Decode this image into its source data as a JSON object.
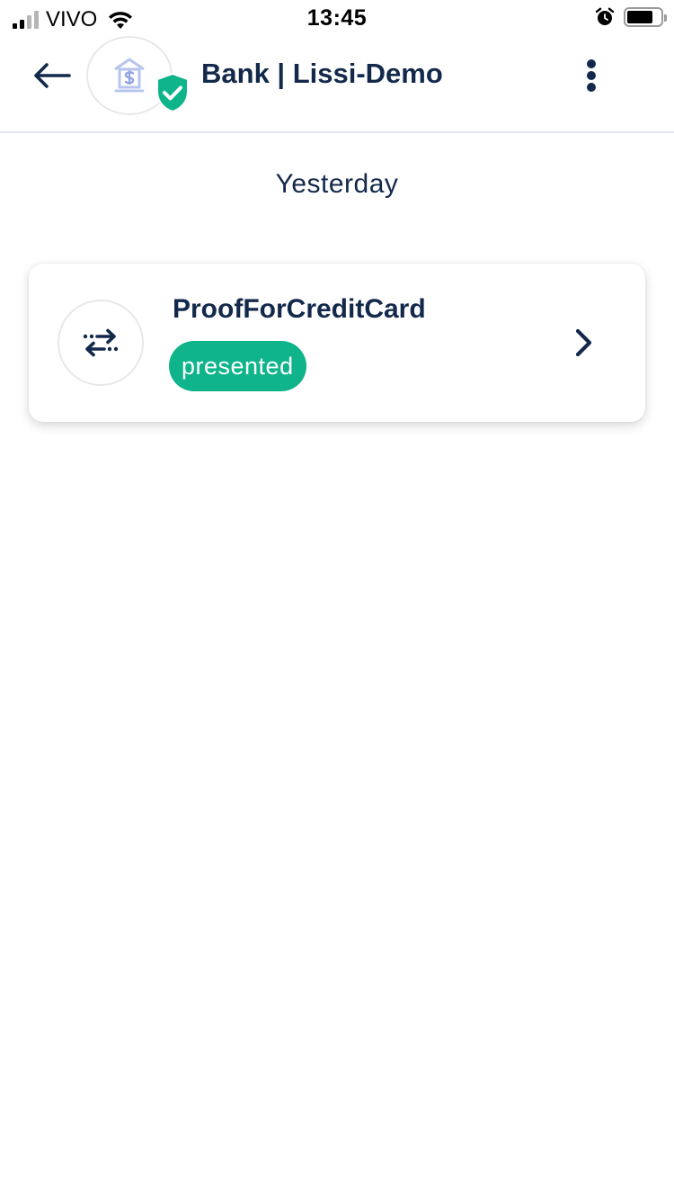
{
  "status_bar": {
    "carrier": "VIVO",
    "time": "13:45",
    "battery_level": 0.78
  },
  "header": {
    "title": "Bank | Lissi-Demo",
    "avatar_icon": "bank-icon",
    "verified_icon": "shield-check-icon"
  },
  "section": {
    "title": "Yesterday"
  },
  "items": [
    {
      "title": "ProofForCreditCard",
      "status": "presented",
      "icon": "exchange-arrows-icon"
    }
  ],
  "colors": {
    "primary": "#13294b",
    "accent": "#0fb48b",
    "divider": "#e3e6ea"
  }
}
